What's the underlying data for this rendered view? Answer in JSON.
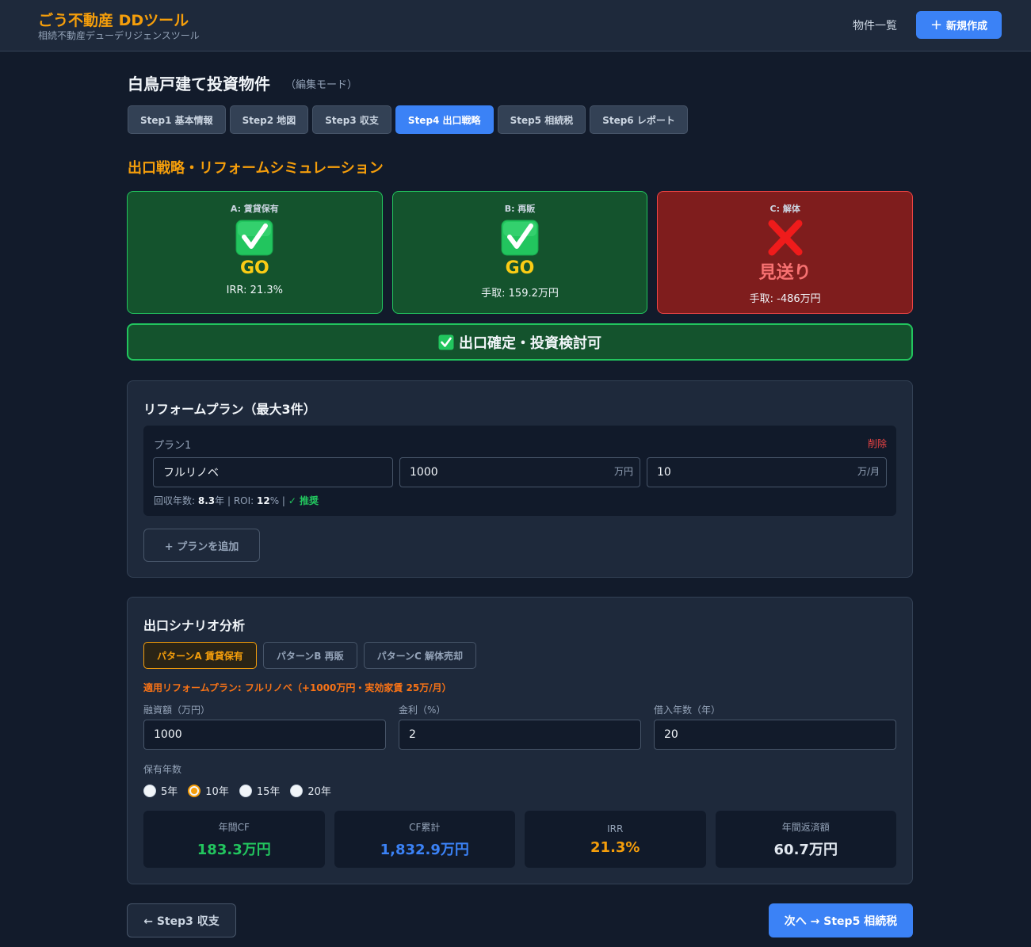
{
  "header": {
    "app_title": "ごう不動産 DDツール",
    "app_subtitle": "相続不動産デューデリジェンスツール",
    "nav_list": "物件一覧",
    "new_button": "新規作成"
  },
  "page": {
    "title": "白鳥戸建て投資物件",
    "mode": "（編集モード）"
  },
  "steps": [
    {
      "label": "Step1 基本情報",
      "active": false
    },
    {
      "label": "Step2 地図",
      "active": false
    },
    {
      "label": "Step3 収支",
      "active": false
    },
    {
      "label": "Step4 出口戦略",
      "active": true
    },
    {
      "label": "Step5 相続税",
      "active": false
    },
    {
      "label": "Step6 レポート",
      "active": false
    }
  ],
  "section_title": "出口戦略・リフォームシミュレーション",
  "strategies": [
    {
      "label": "A: 賃貸保有",
      "icon": "check-mark-icon",
      "verdict": "GO",
      "detail": "IRR: 21.3%"
    },
    {
      "label": "B: 再販",
      "icon": "check-mark-icon",
      "verdict": "GO",
      "detail": "手取: 159.2万円"
    },
    {
      "label": "C: 解体",
      "icon": "cross-mark-icon",
      "verdict": "見送り",
      "detail": "手取: -486万円"
    }
  ],
  "banner": {
    "text": "出口確定・投資検討可"
  },
  "reform": {
    "title": "リフォームプラン（最大3件）",
    "plan": {
      "name": "プラン1",
      "delete_label": "削除",
      "plan_name_value": "フルリノベ",
      "cost_value": "1000",
      "cost_unit": "万円",
      "rent_value": "10",
      "rent_unit": "万/月",
      "payback_label": "回収年数:",
      "payback_value": "8.3",
      "payback_unit": "年 | ROI:",
      "roi_value": "12",
      "roi_unit": "% |",
      "recommend": "✓ 推奨"
    },
    "add_button": "+ プランを追加"
  },
  "scenario": {
    "title": "出口シナリオ分析",
    "patterns": [
      {
        "label": "パターンA 賃貸保有",
        "active": true
      },
      {
        "label": "パターンB 再販",
        "active": false
      },
      {
        "label": "パターンC 解体売却",
        "active": false
      }
    ],
    "applied_plan": "適用リフォームプラン: フルリノベ（+1000万円・実効家賃 25万/月）",
    "fields": [
      {
        "label": "融資額（万円）",
        "value": "1000"
      },
      {
        "label": "金利（%）",
        "value": "2"
      },
      {
        "label": "借入年数（年）",
        "value": "20"
      }
    ],
    "hold_label": "保有年数",
    "hold_options": [
      {
        "label": "5年",
        "selected": false
      },
      {
        "label": "10年",
        "selected": true
      },
      {
        "label": "15年",
        "selected": false
      },
      {
        "label": "20年",
        "selected": false
      }
    ],
    "metrics": [
      {
        "label": "年間CF",
        "value": "183.3万円",
        "color": "#22c55e"
      },
      {
        "label": "CF累計",
        "value": "1,832.9万円",
        "color": "#3b82f6"
      },
      {
        "label": "IRR",
        "value": "21.3%",
        "color": "#f59e0b"
      },
      {
        "label": "年間返済額",
        "value": "60.7万円",
        "color": "#e2e8f0"
      }
    ]
  },
  "footer": {
    "back_button": "← Step3 収支",
    "next_button": "次へ → Step5 相続税"
  },
  "colors": {
    "accent": "#f59e0b",
    "primary": "#3b82f6",
    "success": "#22c55e",
    "danger": "#ef4444"
  }
}
